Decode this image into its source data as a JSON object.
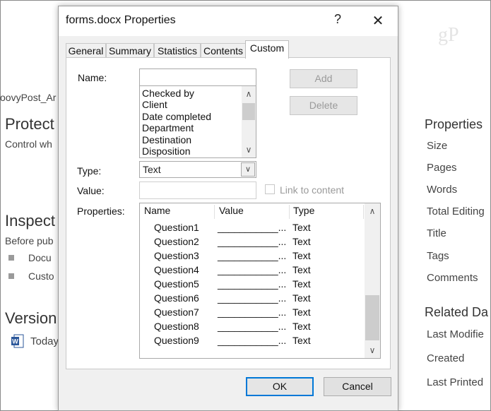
{
  "background": {
    "left": {
      "filename_fragment": "oovyPost_Ar",
      "protect_heading": "Protect",
      "protect_sub": "Control wh",
      "inspect_heading": "Inspect",
      "inspect_sub": "Before pub",
      "inspect_items": [
        "Docu",
        "Custo"
      ],
      "versions_heading": "Version",
      "version_item": "Today"
    },
    "right": {
      "properties_heading": "Properties",
      "property_items": [
        "Size",
        "Pages",
        "Words",
        "Total Editing",
        "Title",
        "Tags",
        "Comments"
      ],
      "related_heading": "Related Da",
      "related_items": [
        "Last Modifie",
        "Created",
        "Last Printed"
      ]
    },
    "watermark": "gP"
  },
  "dialog": {
    "title": "forms.docx Properties",
    "help_label": "?",
    "close_label": "✕",
    "tabs": [
      {
        "label": "General",
        "active": false
      },
      {
        "label": "Summary",
        "active": false
      },
      {
        "label": "Statistics",
        "active": false
      },
      {
        "label": "Contents",
        "active": false
      },
      {
        "label": "Custom",
        "active": true
      }
    ],
    "custom": {
      "name_label": "Name:",
      "name_value": "",
      "name_options": [
        "Checked by",
        "Client",
        "Date completed",
        "Department",
        "Destination",
        "Disposition"
      ],
      "add_label": "Add",
      "delete_label": "Delete",
      "type_label": "Type:",
      "type_value": "Text",
      "value_label": "Value:",
      "value_value": "",
      "link_label": "Link to content",
      "properties_label": "Properties:",
      "table_headers": {
        "name": "Name",
        "value": "Value",
        "type": "Type"
      },
      "rows": [
        {
          "name": "Question1",
          "value": "___________...",
          "type": "Text"
        },
        {
          "name": "Question2",
          "value": "___________...",
          "type": "Text"
        },
        {
          "name": "Question3",
          "value": "___________...",
          "type": "Text"
        },
        {
          "name": "Question4",
          "value": "___________...",
          "type": "Text"
        },
        {
          "name": "Question5",
          "value": "___________...",
          "type": "Text"
        },
        {
          "name": "Question6",
          "value": "___________...",
          "type": "Text"
        },
        {
          "name": "Question7",
          "value": "___________...",
          "type": "Text"
        },
        {
          "name": "Question8",
          "value": "___________...",
          "type": "Text"
        },
        {
          "name": "Question9",
          "value": "___________...",
          "type": "Text"
        }
      ]
    },
    "ok_label": "OK",
    "cancel_label": "Cancel"
  },
  "colors": {
    "accent": "#0078d7",
    "disabled_text": "#9a9a9a"
  }
}
